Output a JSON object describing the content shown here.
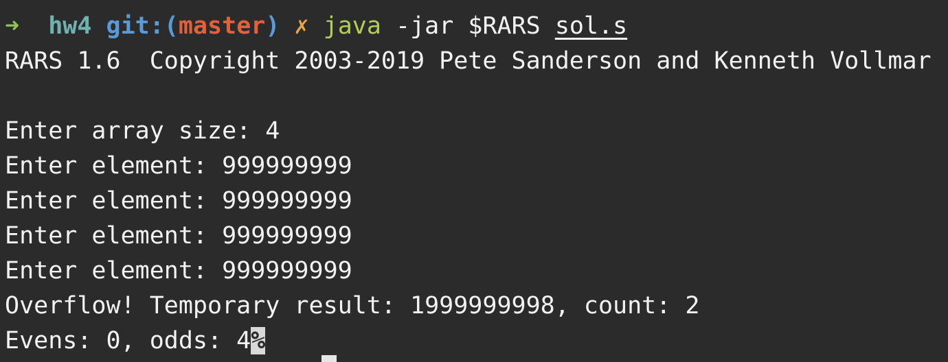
{
  "prompt": {
    "arrow": "➜",
    "directory": "hw4",
    "git_label": "git:",
    "paren_open": "(",
    "branch": "master",
    "paren_close": ")",
    "dirty_mark": "✗",
    "command": "java",
    "args": "-jar $RARS",
    "file": "sol.s"
  },
  "output": {
    "banner": "RARS 1.6  Copyright 2003-2019 Pete Sanderson and Kenneth Vollmar",
    "blank": "",
    "lines": [
      "Enter array size: 4",
      "Enter element: 999999999",
      "Enter element: 999999999",
      "Enter element: 999999999",
      "Enter element: 999999999",
      "Overflow! Temporary result: 1999999998, count: 2"
    ],
    "last_line": "Evens: 0, odds: 4",
    "no_newline_marker": "%"
  },
  "colors": {
    "background": "#2b2b2b",
    "text": "#f2f2f2",
    "arrow": "#8fc653",
    "directory": "#6fb3b0",
    "git": "#5b9bd5",
    "branch": "#e2603b",
    "dirty": "#e8a548",
    "command": "#b3cd57"
  }
}
